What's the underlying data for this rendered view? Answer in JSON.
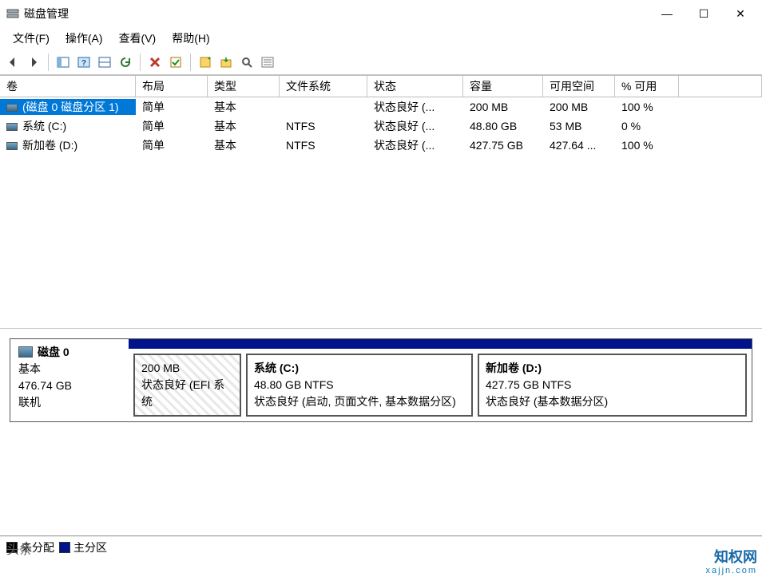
{
  "window": {
    "title": "磁盘管理",
    "controls": {
      "min": "—",
      "max": "☐",
      "close": "✕"
    }
  },
  "menus": {
    "file": "文件(F)",
    "action": "操作(A)",
    "view": "查看(V)",
    "help": "帮助(H)"
  },
  "toolbar": {
    "back": "←",
    "forward": "→",
    "showhide": "▧",
    "help": "?",
    "pane": "▥",
    "refresh": "↻",
    "delete": "✖",
    "check": "✔",
    "new": "▦",
    "mount": "▤",
    "find": "🔍",
    "props": "≣"
  },
  "table": {
    "headers": {
      "volume": "卷",
      "layout": "布局",
      "type": "类型",
      "fs": "文件系统",
      "status": "状态",
      "capacity": "容量",
      "free": "可用空间",
      "pctfree": "% 可用"
    },
    "rows": [
      {
        "volume": "(磁盘 0 磁盘分区 1)",
        "layout": "简单",
        "type": "基本",
        "fs": "",
        "status": "状态良好 (...",
        "capacity": "200 MB",
        "free": "200 MB",
        "pctfree": "100 %",
        "selected": true
      },
      {
        "volume": "系统 (C:)",
        "layout": "简单",
        "type": "基本",
        "fs": "NTFS",
        "status": "状态良好 (...",
        "capacity": "48.80 GB",
        "free": "53 MB",
        "pctfree": "0 %",
        "selected": false
      },
      {
        "volume": "新加卷 (D:)",
        "layout": "简单",
        "type": "基本",
        "fs": "NTFS",
        "status": "状态良好 (...",
        "capacity": "427.75 GB",
        "free": "427.64 ...",
        "pctfree": "100 %",
        "selected": false
      }
    ]
  },
  "disk": {
    "name": "磁盘 0",
    "kind": "基本",
    "size": "476.74 GB",
    "state": "联机",
    "partitions": [
      {
        "name": "",
        "size": "200 MB",
        "info": "状态良好 (EFI 系统",
        "cls": "efi"
      },
      {
        "name": "系统  (C:)",
        "size": "48.80 GB NTFS",
        "info": "状态良好 (启动, 页面文件, 基本数据分区)",
        "cls": "sys"
      },
      {
        "name": "新加卷  (D:)",
        "size": "427.75 GB NTFS",
        "info": "状态良好 (基本数据分区)",
        "cls": "data"
      }
    ]
  },
  "legend": {
    "unalloc": "未分配",
    "primary": "主分区"
  },
  "watermarks": {
    "left": "头条",
    "right_main": "知权网",
    "right_sub": "xajjn.com"
  }
}
